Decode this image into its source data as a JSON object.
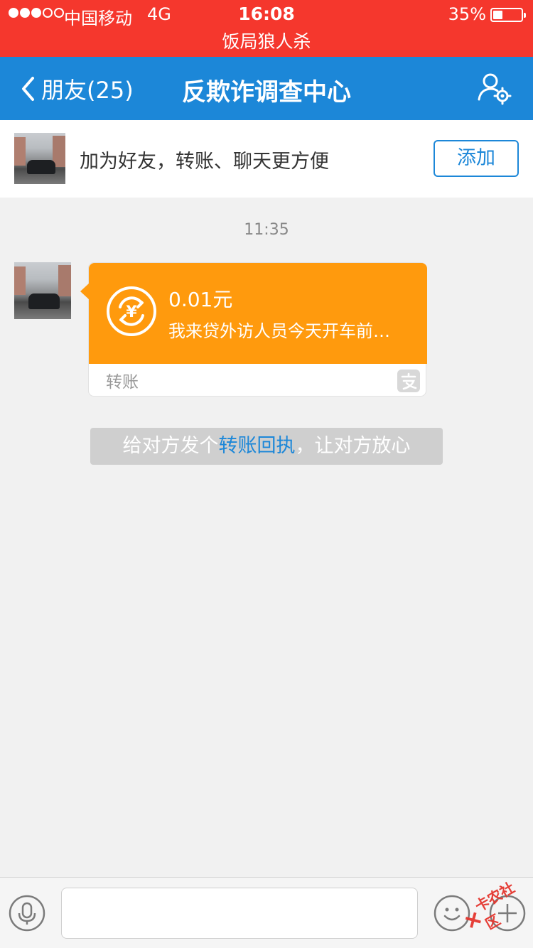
{
  "status_bar": {
    "carrier": "中国移动",
    "network": "4G",
    "time": "16:08",
    "battery_percent": "35%",
    "battery_level": 0.35,
    "signal_bars_filled": 3,
    "signal_bars_total": 5,
    "banner": "饭局狼人杀"
  },
  "nav": {
    "back_label": "朋友(25)",
    "title": "反欺诈调查中心",
    "settings_icon": "profile-settings-icon"
  },
  "add_friend": {
    "text": "加为好友，转账、聊天更方便",
    "button_label": "添加"
  },
  "chat": {
    "timestamp": "11:35",
    "transfer": {
      "amount": "0.01元",
      "note": "我来贷外访人员今天开车前…",
      "label": "转账",
      "icon": "yuan-transfer-icon",
      "brand_icon": "alipay-icon"
    },
    "receipt_tip": {
      "prefix": "给对方发个",
      "link": "转账回执",
      "suffix": "，让对方放心"
    }
  },
  "input_bar": {
    "text_value": "",
    "icons": [
      "microphone-icon",
      "emoji-icon",
      "plus-icon"
    ]
  },
  "watermark": {
    "text": "卡农社区"
  },
  "colors": {
    "status_bar": "#f5372d",
    "nav_bar": "#1c87d8",
    "transfer_card": "#ff9a0d",
    "link": "#1c87d8"
  }
}
